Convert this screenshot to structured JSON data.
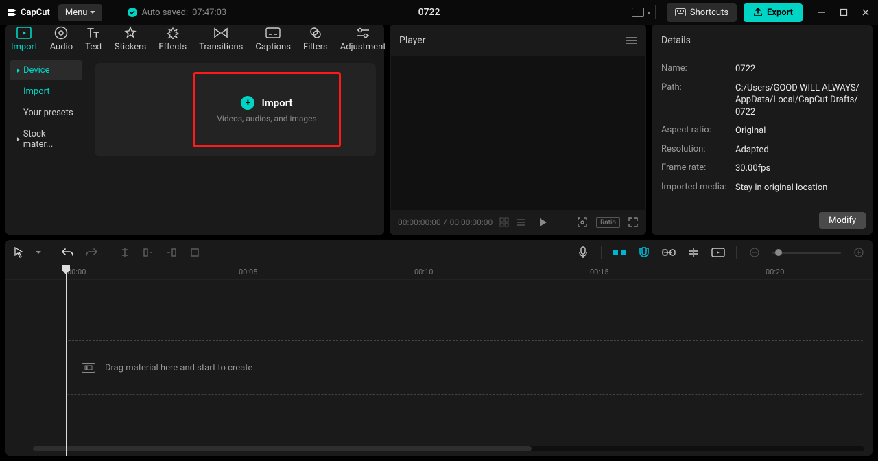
{
  "app": {
    "name": "CapCut"
  },
  "titlebar": {
    "menu_label": "Menu",
    "autosave_prefix": "Auto saved:",
    "autosave_time": "07:47:03",
    "project_title": "0722",
    "shortcuts_label": "Shortcuts",
    "export_label": "Export"
  },
  "top_tabs": [
    {
      "label": "Import",
      "active": true
    },
    {
      "label": "Audio"
    },
    {
      "label": "Text"
    },
    {
      "label": "Stickers"
    },
    {
      "label": "Effects"
    },
    {
      "label": "Transitions"
    },
    {
      "label": "Captions"
    },
    {
      "label": "Filters"
    },
    {
      "label": "Adjustment"
    }
  ],
  "sidebar": {
    "items": [
      {
        "label": "Device",
        "active": true,
        "caret": true
      },
      {
        "label": "Import",
        "link": true
      },
      {
        "label": "Your presets"
      },
      {
        "label": "Stock mater...",
        "caret": true
      }
    ]
  },
  "import_card": {
    "title": "Import",
    "subtitle": "Videos, audios, and images"
  },
  "player": {
    "title": "Player",
    "time_current": "00:00:00:00",
    "time_sep": " / ",
    "time_total": "00:00:00:00",
    "ratio_label": "Ratio"
  },
  "details": {
    "title": "Details",
    "rows": [
      {
        "label": "Name:",
        "value": "0722"
      },
      {
        "label": "Path:",
        "value": "C:/Users/GOOD WILL ALWAYS/AppData/Local/CapCut Drafts/0722"
      },
      {
        "label": "Aspect ratio:",
        "value": "Original"
      },
      {
        "label": "Resolution:",
        "value": "Adapted"
      },
      {
        "label": "Frame rate:",
        "value": "30.00fps"
      },
      {
        "label": "Imported media:",
        "value": "Stay in original location"
      }
    ],
    "modify_label": "Modify"
  },
  "timeline": {
    "marks": [
      "00:00",
      "00:05",
      "00:10",
      "00:15",
      "00:20"
    ],
    "drop_hint": "Drag material here and start to create"
  }
}
